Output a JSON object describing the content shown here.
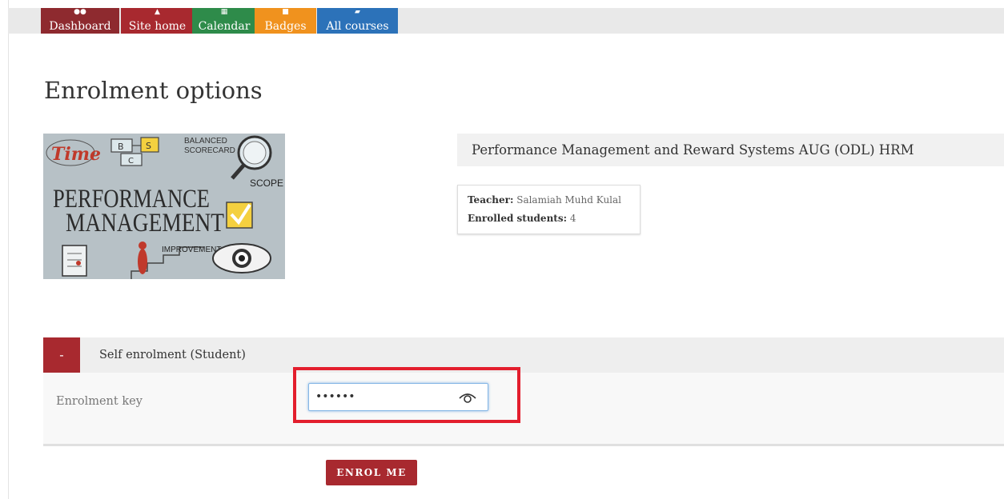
{
  "nav": {
    "items": [
      {
        "label": "Dashboard",
        "icon": "dashboard-icon",
        "color": "#8e2a2f"
      },
      {
        "label": "Site home",
        "icon": "home-icon",
        "color": "#a8292f"
      },
      {
        "label": "Calendar",
        "icon": "calendar-icon",
        "color": "#2e8b4a"
      },
      {
        "label": "Badges",
        "icon": "bookmark-icon",
        "color": "#f0921e"
      },
      {
        "label": "All courses",
        "icon": "book-icon",
        "color": "#2c72b9"
      }
    ]
  },
  "page": {
    "title": "Enrolment options"
  },
  "course": {
    "title": "Performance Management and Reward Systems AUG (ODL) HRM",
    "image_words": {
      "time": "Time",
      "b": "B",
      "s": "S",
      "c": "C",
      "balanced": "BALANCED",
      "scorecard": "SCORECARD",
      "scope": "SCOPE",
      "performance": "PERFORMANCE",
      "management": "MANAGEMENT",
      "improvement": "IMPROVEMENT"
    },
    "teacher_label": "Teacher:",
    "teacher_name": "Salamiah Muhd Kulal",
    "enrolled_label": "Enrolled students:",
    "enrolled_count": "4"
  },
  "enrolment": {
    "section_toggle": "-",
    "section_title": "Self enrolment (Student)",
    "key_label": "Enrolment key",
    "key_value": "••••••",
    "enrol_button": "ENROL ME"
  },
  "colors": {
    "accent": "#a8292f",
    "highlight": "#e31e2d",
    "focus_border": "#86b7e6"
  }
}
